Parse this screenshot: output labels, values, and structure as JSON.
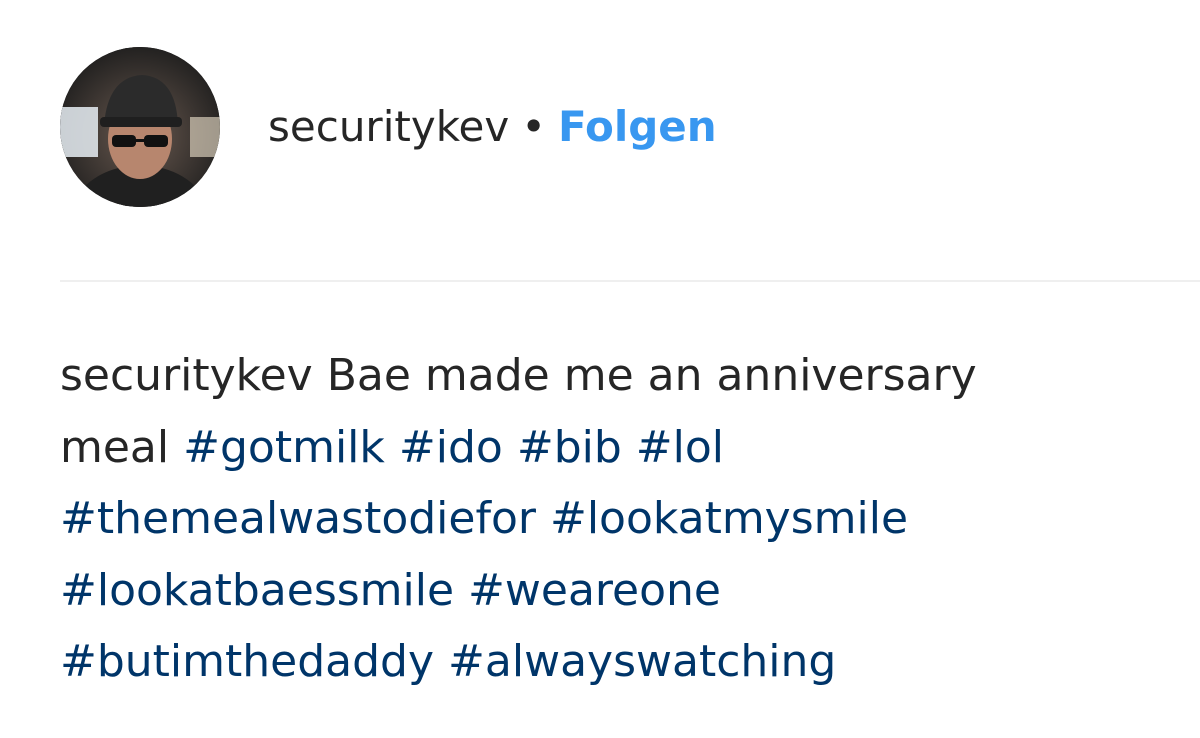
{
  "post": {
    "username": "securitykev",
    "separator": "•",
    "follow_label": "Folgen",
    "avatar_icon": "profile-photo-avatar"
  },
  "caption": {
    "username": "securitykev",
    "text_line1": "Bae made me an anniversary",
    "text_line2": "meal",
    "hashtags": [
      "#gotmilk",
      "#ido",
      "#bib",
      "#lol",
      "#themealwastodiefor",
      "#lookatmysmile",
      "#lookatbaessmile",
      "#weareone",
      "#butimthedaddy",
      "#alwayswatching"
    ]
  },
  "colors": {
    "text": "#262626",
    "follow": "#3897f0",
    "hashtag": "#003569",
    "divider": "#efefef"
  }
}
